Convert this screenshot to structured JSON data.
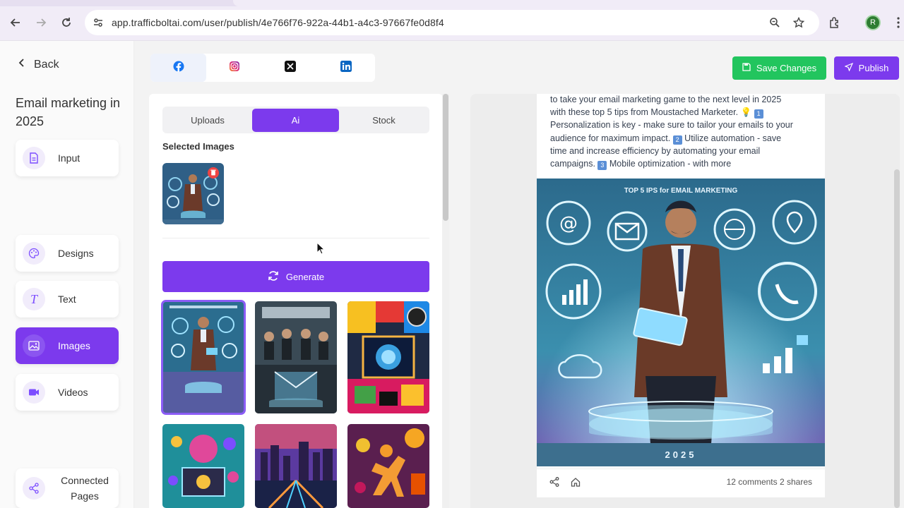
{
  "browser": {
    "url": "app.trafficboltai.com/user/publish/4e766f76-922a-44b1-a4c3-97667fe0d8f4",
    "profile_initial": "R"
  },
  "sidebar": {
    "back_label": "Back",
    "project_title": "Email marketing in 2025",
    "items": [
      {
        "label": "Input",
        "icon": "document-icon",
        "active": false
      },
      {
        "label": "Designs",
        "icon": "palette-icon",
        "active": false
      },
      {
        "label": "Text",
        "icon": "text-icon",
        "active": false
      },
      {
        "label": "Images",
        "icon": "image-icon",
        "active": true
      },
      {
        "label": "Videos",
        "icon": "video-icon",
        "active": false
      },
      {
        "label": "Connected Pages",
        "icon": "share-icon",
        "active": false
      }
    ]
  },
  "social_tabs": [
    {
      "name": "facebook",
      "active": true
    },
    {
      "name": "instagram",
      "active": false
    },
    {
      "name": "x",
      "active": false
    },
    {
      "name": "linkedin",
      "active": false
    }
  ],
  "actions": {
    "save_label": "Save Changes",
    "publish_label": "Publish"
  },
  "image_panel": {
    "source_tabs": [
      "Uploads",
      "Ai",
      "Stock"
    ],
    "active_source": "Ai",
    "selected_label": "Selected Images",
    "generate_label": "Generate"
  },
  "preview": {
    "text_lines": [
      "to take your email marketing game to the next level in 2025",
      "with these top 5 tips from Moustached Marketer. ",
      "Personalization is key - make sure to tailor your emails to your",
      "audience for maximum impact. ",
      "time and increase efficiency by automating your email",
      "campaigns. "
    ],
    "text_segments": {
      "l3_after": " Utilize automation - save",
      "l5_after": " Mobile optimization - with more"
    },
    "emoji_markers": [
      "1",
      "2",
      "3"
    ],
    "image_title": "TOP 5 IPS for EMAIL MARKETING",
    "image_year": "2025",
    "stats": "12 comments 2 shares"
  },
  "colors": {
    "accent": "#7c3aed",
    "save_green": "#22c55e",
    "delete_red": "#ef4444"
  }
}
